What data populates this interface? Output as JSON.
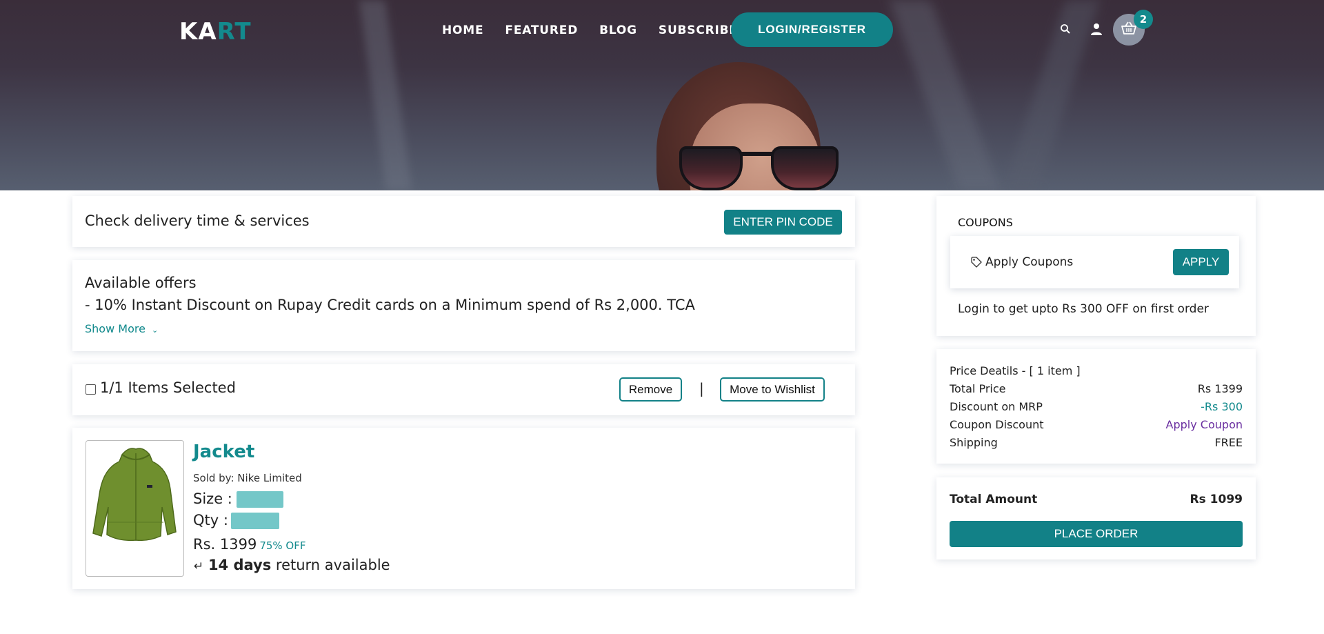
{
  "brand": {
    "logo_part1": "KA",
    "logo_part2": "RT"
  },
  "nav": {
    "items": [
      "HOME",
      "FEATURED",
      "BLOG",
      "SUBSCRIBE"
    ],
    "login_label": "LOGIN/REGISTER",
    "cart_count": "2"
  },
  "delivery": {
    "text": "Check delivery time & services",
    "button": "ENTER PIN CODE"
  },
  "offers": {
    "heading": "Available offers",
    "offer": "- 10% Instant Discount on Rupay Credit cards on a Minimum spend of Rs 2,000. TCA",
    "show_more": "Show More"
  },
  "selection": {
    "label": "1/1 Items Selected",
    "remove": "Remove",
    "separator": "|",
    "wishlist": "Move to Wishlist"
  },
  "item": {
    "name": "Jacket",
    "sold_by": "Sold by: Nike Limited",
    "size_label": "Size :",
    "qty_label": "Qty :",
    "price": "Rs. 1399",
    "discount": "75% OFF",
    "return_days": "14 days",
    "return_text": "return available"
  },
  "coupons": {
    "heading": "COUPONS",
    "apply_text": "Apply Coupons",
    "apply_button": "APPLY",
    "login_note": "Login to get upto Rs 300 OFF on first order"
  },
  "price_details": {
    "heading": "Price Deatils - [ 1 item ]",
    "rows": [
      {
        "label": "Total Price",
        "value": "Rs 1399"
      },
      {
        "label": "Discount on MRP",
        "value": "-Rs 300"
      },
      {
        "label": "Coupon Discount",
        "value": "Apply Coupon"
      },
      {
        "label": "Shipping",
        "value": "FREE"
      }
    ]
  },
  "total": {
    "label": "Total Amount",
    "value": "Rs 1099",
    "button": "PLACE ORDER"
  },
  "colors": {
    "accent": "#128187",
    "accent_text": "#138a8d",
    "coupon_link": "#6a2fa0",
    "pill": "#74c7c8"
  }
}
